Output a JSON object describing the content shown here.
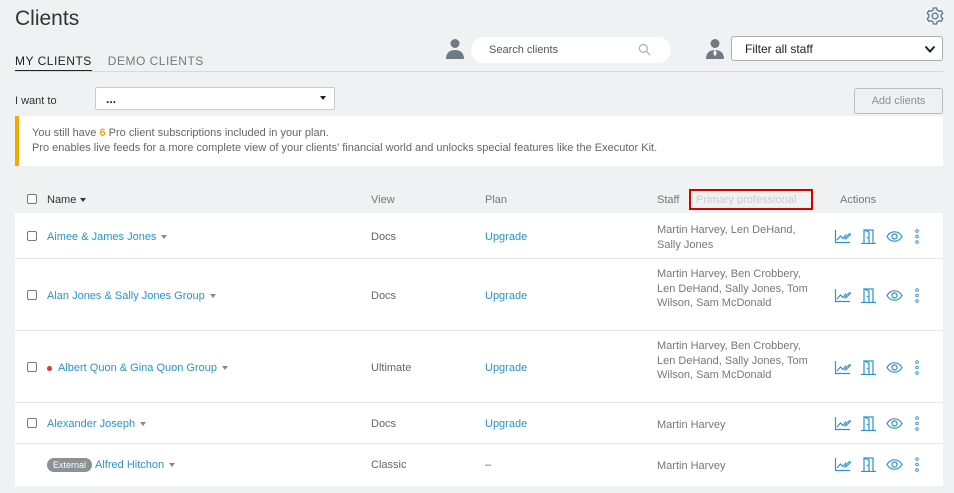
{
  "page": {
    "title": "Clients"
  },
  "tabs": [
    {
      "label": "MY CLIENTS",
      "active": true
    },
    {
      "label": "DEMO CLIENTS",
      "active": false
    }
  ],
  "search": {
    "placeholder": "Search clients"
  },
  "filter": {
    "selected": "Filter all staff"
  },
  "iwant": {
    "label": "I want to",
    "selected": "..."
  },
  "add_button": {
    "label": "Add clients"
  },
  "notice": {
    "pre": "You still have ",
    "count": "6",
    "post": " Pro client subscriptions included in your plan.",
    "line2": "Pro enables live feeds for a more complete view of your clients' financial world and unlocks special features like the Executor Kit.",
    "accent": "#f2a900"
  },
  "table": {
    "headers": {
      "name": "Name",
      "view": "View",
      "plan": "Plan",
      "staff": "Staff",
      "primary": "Primary professional",
      "actions": "Actions"
    },
    "rows": [
      {
        "name": "Aimee & James Jones",
        "view": "Docs",
        "plan": "Upgrade",
        "staff": "Martin Harvey, Len DeHand, Sally Jones",
        "checkbox": true
      },
      {
        "name": "Alan Jones & Sally Jones Group",
        "view": "Docs",
        "plan": "Upgrade",
        "staff": "Martin Harvey, Ben Crobbery, Len DeHand, Sally Jones, Tom Wilson, Sam McDonald",
        "checkbox": true
      },
      {
        "name": "Albert Quon & Gina Quon Group",
        "view": "Ultimate",
        "plan": "Upgrade",
        "staff": "Martin Harvey, Ben Crobbery, Len DeHand, Sally Jones, Tom Wilson, Sam McDonald",
        "checkbox": true,
        "dot": true
      },
      {
        "name": "Alexander Joseph",
        "view": "Docs",
        "plan": "Upgrade",
        "staff": "Martin Harvey",
        "checkbox": true
      },
      {
        "name": "Alfred Hitchon",
        "view": "Classic",
        "plan": "–",
        "staff": "Martin Harvey",
        "checkbox": false,
        "badge": "External"
      }
    ]
  },
  "colors": {
    "link": "#2a93c9",
    "highlight_box": "#d40000",
    "status_dot": "#d9363e"
  },
  "icons": [
    "gear-icon",
    "user-icon",
    "search-icon",
    "chevron-down-icon",
    "chart-edit-icon",
    "door-icon",
    "eye-icon",
    "more-vertical-icon"
  ]
}
